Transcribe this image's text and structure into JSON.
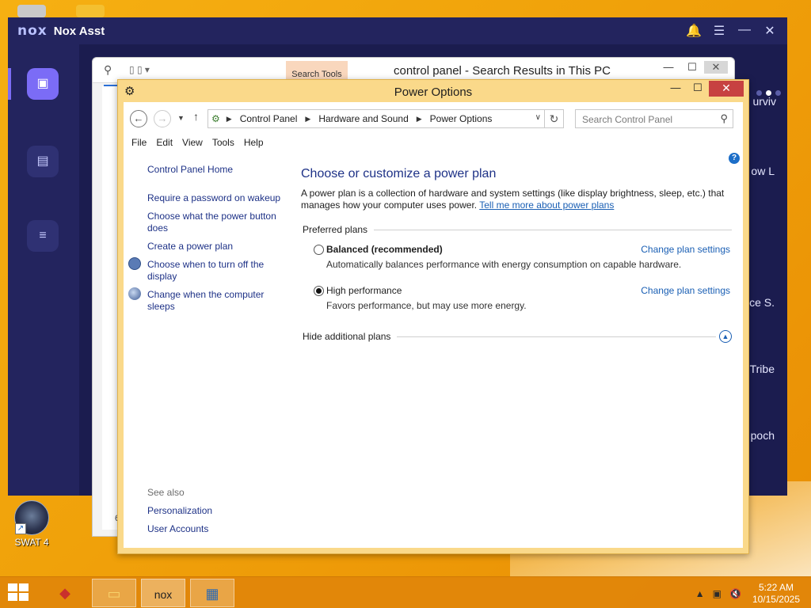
{
  "nox": {
    "logo": "nox",
    "title": "Nox Asst",
    "controls": [
      "🔔",
      "☰",
      "—",
      "✕"
    ],
    "right_texts": [
      "urviv",
      "ow L",
      "ce S.",
      "Tribe",
      "poch"
    ]
  },
  "explorer": {
    "search_tools_label": "Search Tools",
    "title": "control panel - Search Results in This PC",
    "bottom_char": "6"
  },
  "power_options": {
    "window_title": "Power Options",
    "address": {
      "crumbs": [
        "Control Panel",
        "Hardware and Sound",
        "Power Options"
      ],
      "search_placeholder": "Search Control Panel"
    },
    "menu": [
      "File",
      "Edit",
      "View",
      "Tools",
      "Help"
    ],
    "left_pane": {
      "home": "Control Panel Home",
      "links": [
        "Require a password on wakeup",
        "Choose what the power button does",
        "Create a power plan",
        "Choose when to turn off the display",
        "Change when the computer sleeps"
      ],
      "see_also_label": "See also",
      "see_also": [
        "Personalization",
        "User Accounts"
      ]
    },
    "main": {
      "heading": "Choose or customize a power plan",
      "description": "A power plan is a collection of hardware and system settings (like display brightness, sleep, etc.) that manages how your computer uses power.",
      "description_link": "Tell me more about power plans",
      "preferred_label": "Preferred plans",
      "plans": [
        {
          "name": "Balanced (recommended)",
          "desc": "Automatically balances performance with energy consumption on capable hardware.",
          "link": "Change plan settings",
          "selected": false
        },
        {
          "name": "High performance",
          "desc": "Favors performance, but may use more energy.",
          "link": "Change plan settings",
          "selected": true
        }
      ],
      "hide_label": "Hide additional plans"
    }
  },
  "desktop": {
    "shortcut_label": "SWAT 4"
  },
  "taskbar": {
    "time": "5:22 AM",
    "date": "10/15/2025"
  }
}
